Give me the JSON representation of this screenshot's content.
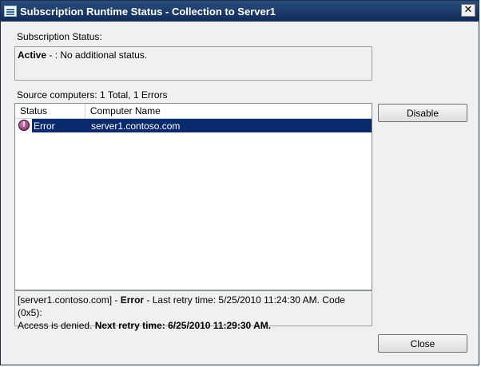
{
  "window": {
    "title": "Subscription Runtime Status - Collection to Server1",
    "close_glyph": "✕"
  },
  "subscription_status": {
    "label": "Subscription Status:",
    "state": "Active",
    "separator": " - : ",
    "message": "No additional status."
  },
  "source_computers": {
    "summary": "Source computers: 1 Total, 1 Errors",
    "columns": [
      "Status",
      "Computer Name"
    ],
    "rows": [
      {
        "icon": "error-icon",
        "status": "Error",
        "computer_name": "server1.contoso.com",
        "selected": true
      }
    ]
  },
  "details": {
    "line1_prefix": "[server1.contoso.com] - ",
    "line1_status": "Error",
    "line1_rest": " - Last retry time: 5/25/2010 11:24:30 AM. Code (0x5):",
    "line2_prefix": "Access is denied.  ",
    "line2_next": "Next retry time: 6/25/2010 11:29:30 AM."
  },
  "buttons": {
    "disable": "Disable",
    "close": "Close"
  }
}
